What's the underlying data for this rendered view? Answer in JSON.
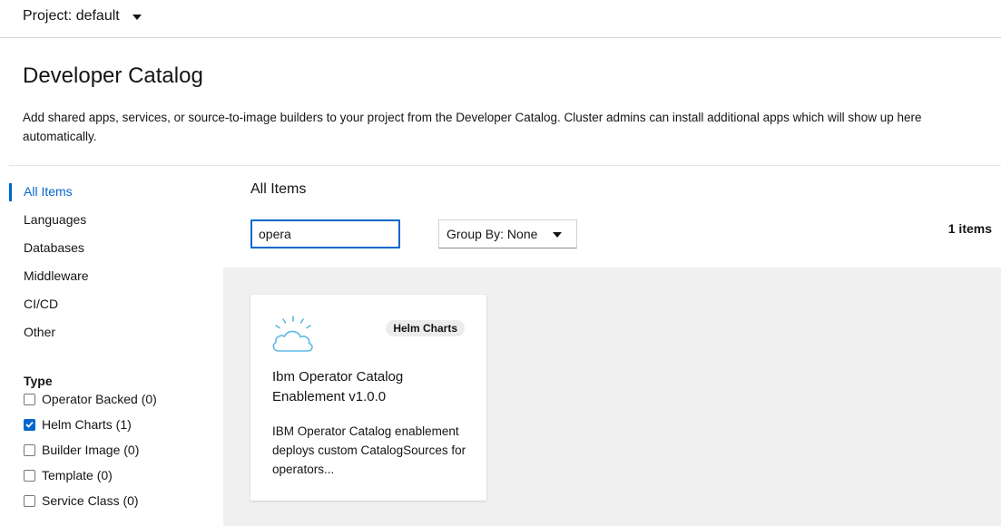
{
  "header": {
    "project_label": "Project: default"
  },
  "page": {
    "title": "Developer Catalog",
    "description": "Add shared apps, services, or source-to-image builders to your project from the Developer Catalog. Cluster admins can install additional apps which will show up here automatically."
  },
  "sidebar": {
    "categories": [
      "All Items",
      "Languages",
      "Databases",
      "Middleware",
      "CI/CD",
      "Other"
    ],
    "active_category": "All Items",
    "type_heading": "Type",
    "type_filters": [
      {
        "label": "Operator Backed (0)",
        "checked": false
      },
      {
        "label": "Helm Charts (1)",
        "checked": true
      },
      {
        "label": "Builder Image (0)",
        "checked": false
      },
      {
        "label": "Template (0)",
        "checked": false
      },
      {
        "label": "Service Class (0)",
        "checked": false
      }
    ]
  },
  "main": {
    "section_title": "All Items",
    "filter_value": "opera",
    "group_by_label": "Group By: None",
    "items_count": "1 items"
  },
  "tiles": [
    {
      "badge": "Helm Charts",
      "title": "Ibm Operator Catalog Enablement v1.0.0",
      "description": "IBM Operator Catalog enablement deploys custom CatalogSources for operators...",
      "icon": "ibm-cloud-icon"
    }
  ],
  "colors": {
    "accent": "#0066cc",
    "catalog_bg": "#f0f0f0",
    "icon_blue": "#5cb8e6"
  }
}
